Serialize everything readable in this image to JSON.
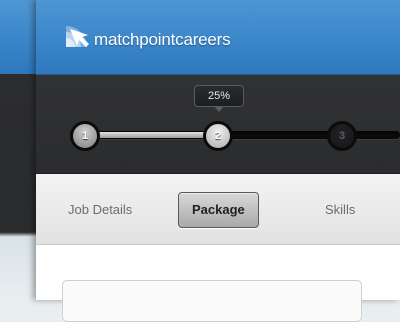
{
  "brand": {
    "name": "matchpointcareers",
    "logo_icon": "radar-arrow-icon",
    "accent_color": "#3a85c9"
  },
  "progress": {
    "tooltip": "25%",
    "fraction": 0.25,
    "steps": [
      {
        "label": "1",
        "state": "done"
      },
      {
        "label": "2",
        "state": "current"
      },
      {
        "label": "3",
        "state": "upcoming"
      }
    ]
  },
  "tabs": [
    {
      "label": "Job Details",
      "active": false
    },
    {
      "label": "Package",
      "active": true
    },
    {
      "label": "Skills",
      "active": false
    }
  ]
}
